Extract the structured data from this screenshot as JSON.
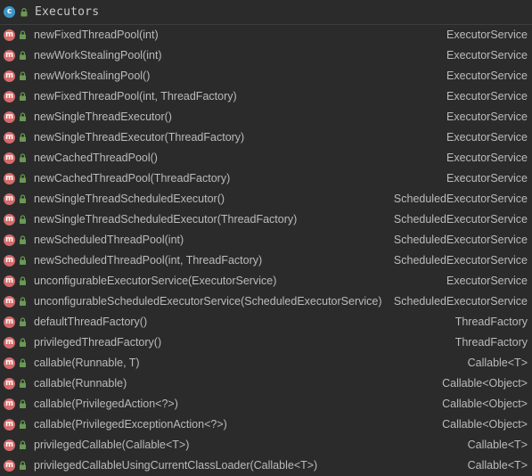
{
  "header": {
    "class_icon_letter": "c",
    "title": "Executors"
  },
  "colors": {
    "background": "#2b2b2b",
    "method_icon": "#d66b6b",
    "class_icon": "#3d97c7",
    "lock_green": "#6a9955",
    "text": "#bbbbbb"
  },
  "method_icon_letter": "m",
  "methods": [
    {
      "name": "newFixedThreadPool(int)",
      "returns": "ExecutorService"
    },
    {
      "name": "newWorkStealingPool(int)",
      "returns": "ExecutorService"
    },
    {
      "name": "newWorkStealingPool()",
      "returns": "ExecutorService"
    },
    {
      "name": "newFixedThreadPool(int, ThreadFactory)",
      "returns": "ExecutorService"
    },
    {
      "name": "newSingleThreadExecutor()",
      "returns": "ExecutorService"
    },
    {
      "name": "newSingleThreadExecutor(ThreadFactory)",
      "returns": "ExecutorService"
    },
    {
      "name": "newCachedThreadPool()",
      "returns": "ExecutorService"
    },
    {
      "name": "newCachedThreadPool(ThreadFactory)",
      "returns": "ExecutorService"
    },
    {
      "name": "newSingleThreadScheduledExecutor()",
      "returns": "ScheduledExecutorService"
    },
    {
      "name": "newSingleThreadScheduledExecutor(ThreadFactory)",
      "returns": "ScheduledExecutorService"
    },
    {
      "name": "newScheduledThreadPool(int)",
      "returns": "ScheduledExecutorService"
    },
    {
      "name": "newScheduledThreadPool(int, ThreadFactory)",
      "returns": "ScheduledExecutorService"
    },
    {
      "name": "unconfigurableExecutorService(ExecutorService)",
      "returns": "ExecutorService"
    },
    {
      "name": "unconfigurableScheduledExecutorService(ScheduledExecutorService)",
      "returns": "ScheduledExecutorService"
    },
    {
      "name": "defaultThreadFactory()",
      "returns": "ThreadFactory"
    },
    {
      "name": "privilegedThreadFactory()",
      "returns": "ThreadFactory"
    },
    {
      "name": "callable(Runnable, T)",
      "returns": "Callable<T>"
    },
    {
      "name": "callable(Runnable)",
      "returns": "Callable<Object>"
    },
    {
      "name": "callable(PrivilegedAction<?>)",
      "returns": "Callable<Object>"
    },
    {
      "name": "callable(PrivilegedExceptionAction<?>)",
      "returns": "Callable<Object>"
    },
    {
      "name": "privilegedCallable(Callable<T>)",
      "returns": "Callable<T>"
    },
    {
      "name": "privilegedCallableUsingCurrentClassLoader(Callable<T>)",
      "returns": "Callable<T>"
    }
  ]
}
